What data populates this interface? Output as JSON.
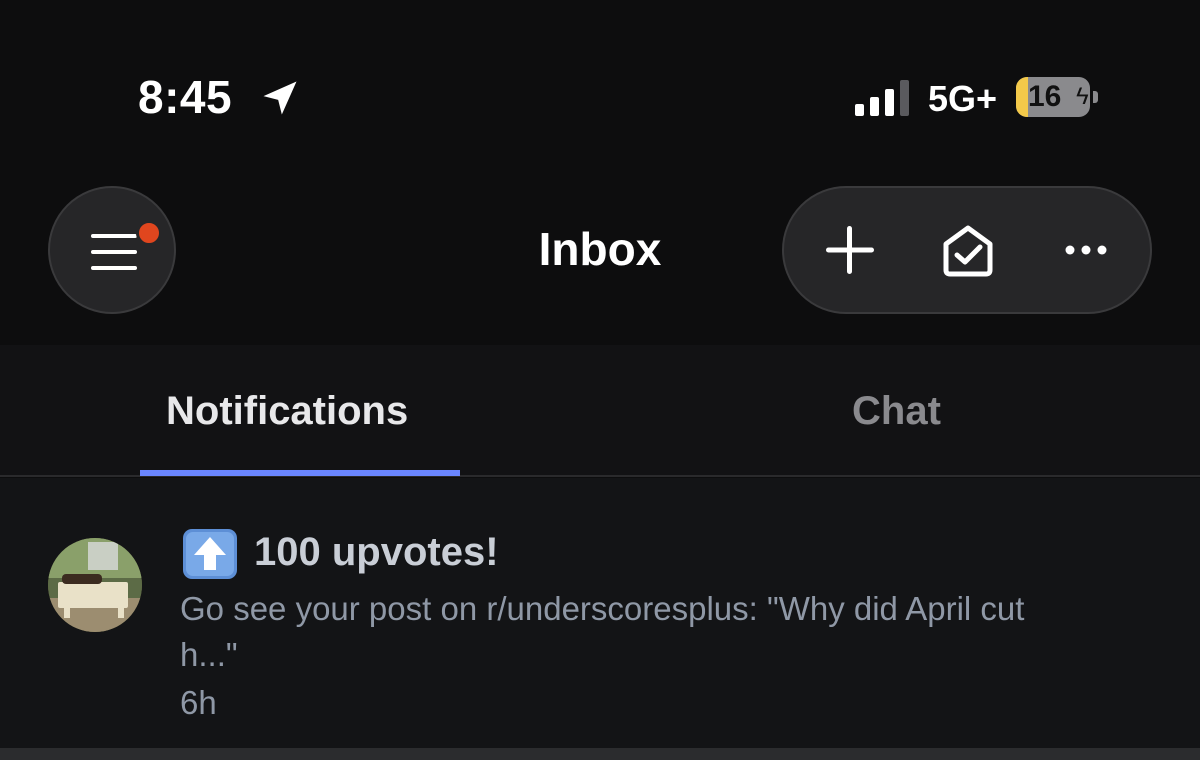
{
  "status_bar": {
    "time": "8:45",
    "network": "5G+",
    "battery_text": "16",
    "battery_level": 0.16
  },
  "header": {
    "title": "Inbox",
    "menu_icon": "hamburger-menu-icon",
    "actions": [
      "plus-icon",
      "mark-read-envelope-icon",
      "more-dots-icon"
    ]
  },
  "tabs": [
    {
      "label": "Notifications",
      "active": true
    },
    {
      "label": "Chat",
      "active": false
    }
  ],
  "notifications": [
    {
      "icon": "up-arrow-emoji-icon",
      "title": "100 upvotes!",
      "body": "Go see your post on r/underscoresplus: \"Why did April cut h...\"",
      "time": "6h"
    }
  ],
  "colors": {
    "accent_underline": "#6a86ff",
    "badge_dot": "#e0461e",
    "background": "#0d0d0e"
  }
}
